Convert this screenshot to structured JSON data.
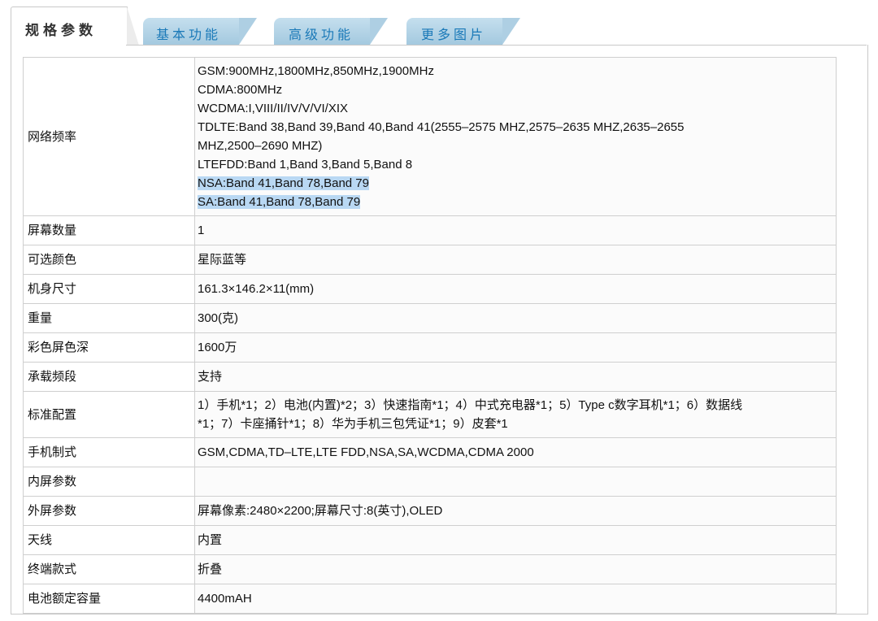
{
  "tabs": [
    {
      "label": "规格参数",
      "active": true
    },
    {
      "label": "基本功能",
      "active": false
    },
    {
      "label": "高级功能",
      "active": false
    },
    {
      "label": "更多图片",
      "active": false
    }
  ],
  "specs": {
    "network_frequency": {
      "label": "网络频率",
      "lines": [
        "GSM:900MHz,1800MHz,850MHz,1900MHz",
        "CDMA:800MHz",
        "WCDMA:I,VIII/II/IV/V/VI/XIX",
        "TDLTE:Band 38,Band 39,Band 40,Band 41(2555–2575 MHZ,2575–2635 MHZ,2635–2655",
        "MHZ,2500–2690 MHZ)",
        "LTEFDD:Band 1,Band 3,Band 5,Band 8",
        "NSA:Band 41,Band 78,Band 79",
        "SA:Band 41,Band 78,Band 79"
      ]
    },
    "screen_count": {
      "label": "屏幕数量",
      "value": "1"
    },
    "colors": {
      "label": "可选颜色",
      "value": "星际蓝等"
    },
    "dimensions": {
      "label": "机身尺寸",
      "value": "161.3×146.2×11(mm)"
    },
    "weight": {
      "label": "重量",
      "value": "300(克)"
    },
    "color_depth": {
      "label": "彩色屏色深",
      "value": "1600万"
    },
    "carrier_bands": {
      "label": "承载频段",
      "value": "支持"
    },
    "standard_config": {
      "label": "标准配置",
      "lines": [
        "1）手机*1；2）电池(内置)*2；3）快速指南*1；4）中式充电器*1；5）Type c数字耳机*1；6）数据线",
        "*1；7）卡座捅针*1；8）华为手机三包凭证*1；9）皮套*1"
      ]
    },
    "network_standard": {
      "label": "手机制式",
      "value": "GSM,CDMA,TD–LTE,LTE FDD,NSA,SA,WCDMA,CDMA 2000"
    },
    "inner_screen": {
      "label": "内屏参数",
      "value": ""
    },
    "outer_screen": {
      "label": "外屏参数",
      "value": "屏幕像素:2480×2200;屏幕尺寸:8(英寸),OLED"
    },
    "antenna": {
      "label": "天线",
      "value": "内置"
    },
    "terminal_style": {
      "label": "终端款式",
      "value": "折叠"
    },
    "battery_capacity": {
      "label": "电池额定容量",
      "value": "4400mAH"
    }
  },
  "colors": {
    "tab_text": "#1a79b8",
    "tab_bg": "#b5d6ea",
    "highlight": "#b9d8f3",
    "border": "#cfcfcf"
  }
}
